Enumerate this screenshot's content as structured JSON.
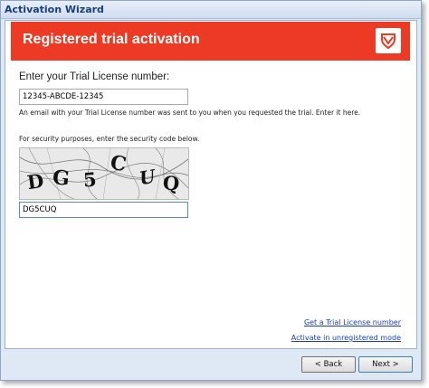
{
  "window": {
    "title": "Activation Wizard"
  },
  "banner": {
    "heading": "Registered trial activation",
    "logo_icon": "shield-icon",
    "color": "#ec3a24"
  },
  "license": {
    "label": "Enter your Trial License number:",
    "value": "12345-ABCDE-12345",
    "help": "An email with your Trial License number was sent to you when you requested the trial. Enter it here."
  },
  "security": {
    "instruction": "For security purposes, enter the security code below.",
    "captcha_text": "DG5CUQ",
    "code_value": "DG5CUQ"
  },
  "links": {
    "get_license": "Get a Trial License number",
    "activate_unregistered": "Activate in unregistered mode"
  },
  "footer": {
    "back_label": "< Back",
    "next_label": "Next >"
  }
}
